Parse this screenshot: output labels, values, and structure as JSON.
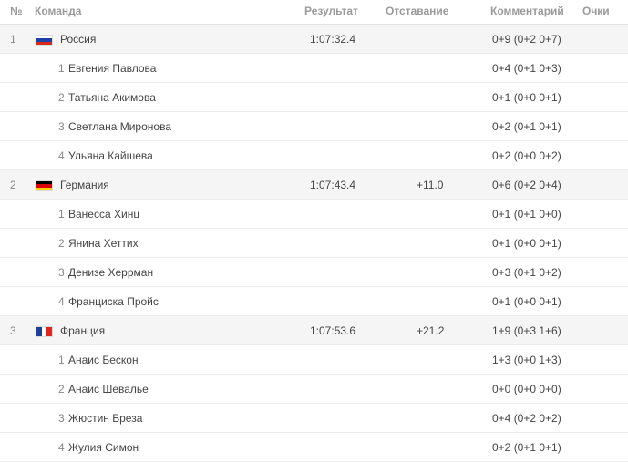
{
  "header": {
    "num": "№",
    "team": "Команда",
    "result": "Результат",
    "gap": "Отставание",
    "comment": "Комментарий",
    "points": "Очки"
  },
  "teams": [
    {
      "place": "1",
      "name": "Россия",
      "flag": "russia-flag-icon",
      "flag_colors": [
        "#ffffff",
        "#1c3fa8",
        "#d52b1e"
      ],
      "result": "1:07:32.4",
      "gap": "",
      "comment": "0+9 (0+2 0+7)",
      "members": [
        {
          "idx": "1",
          "name": "Евгения Павлова",
          "comment": "0+4 (0+1 0+3)"
        },
        {
          "idx": "2",
          "name": "Татьяна Акимова",
          "comment": "0+1 (0+0 0+1)"
        },
        {
          "idx": "3",
          "name": "Светлана Миронова",
          "comment": "0+2 (0+1 0+1)"
        },
        {
          "idx": "4",
          "name": "Ульяна Кайшева",
          "comment": "0+2 (0+0 0+2)"
        }
      ]
    },
    {
      "place": "2",
      "name": "Германия",
      "flag": "germany-flag-icon",
      "flag_colors": [
        "#000000",
        "#dd0000",
        "#ffce00"
      ],
      "result": "1:07:43.4",
      "gap": "+11.0",
      "comment": "0+6 (0+2 0+4)",
      "members": [
        {
          "idx": "1",
          "name": "Ванесса Хинц",
          "comment": "0+1 (0+1 0+0)"
        },
        {
          "idx": "2",
          "name": "Янина Хеттих",
          "comment": "0+1 (0+0 0+1)"
        },
        {
          "idx": "3",
          "name": "Денизе Херрман",
          "comment": "0+3 (0+1 0+2)"
        },
        {
          "idx": "4",
          "name": "Франциска Пройс",
          "comment": "0+1 (0+0 0+1)"
        }
      ]
    },
    {
      "place": "3",
      "name": "Франция",
      "flag": "france-flag-icon",
      "flag_colors": [
        "#1f3f99",
        "#ffffff",
        "#e1241d"
      ],
      "result": "1:07:53.6",
      "gap": "+21.2",
      "comment": "1+9 (0+3 1+6)",
      "members": [
        {
          "idx": "1",
          "name": "Анаис Бескон",
          "comment": "1+3 (0+0 1+3)"
        },
        {
          "idx": "2",
          "name": "Анаис Шевалье",
          "comment": "0+0 (0+0 0+0)"
        },
        {
          "idx": "3",
          "name": "Жюстин Бреза",
          "comment": "0+4 (0+2 0+2)"
        },
        {
          "idx": "4",
          "name": "Жулия Симон",
          "comment": "0+2 (0+1 0+1)"
        }
      ]
    }
  ]
}
